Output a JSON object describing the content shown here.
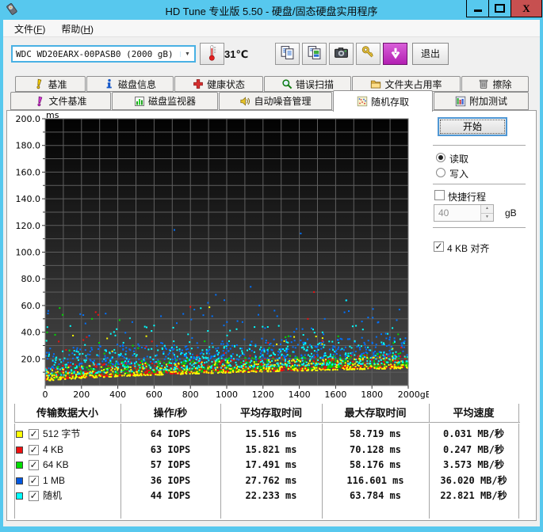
{
  "window": {
    "title": "HD Tune 专业版 5.50 - 硬盘/固态硬盘实用程序",
    "close_glyph": "X"
  },
  "menu": {
    "items": [
      {
        "id": "file",
        "pre": "文件(",
        "accel": "F",
        "post": ")"
      },
      {
        "id": "help",
        "pre": "帮助(",
        "accel": "H",
        "post": ")"
      }
    ]
  },
  "toolbar": {
    "drive_select": {
      "value": "WDC WD20EARX-00PASB0 (2000 gB)",
      "icon": "dropdown-arrow-icon"
    },
    "thermometer_icon": "thermometer-icon",
    "temperature": "31℃",
    "buttons": [
      {
        "icon": "copy-text-icon"
      },
      {
        "icon": "copy-image-icon"
      },
      {
        "icon": "screenshot-icon"
      },
      {
        "icon": "options-icon"
      },
      {
        "icon": "update-icon"
      }
    ],
    "exit_label": "退出"
  },
  "tabs": {
    "row1": [
      {
        "id": "benchmark",
        "label": "基准",
        "icon": "benchmark-icon"
      },
      {
        "id": "disk-info",
        "label": "磁盘信息",
        "icon": "disk-info-icon"
      },
      {
        "id": "health",
        "label": "健康状态",
        "icon": "health-icon"
      },
      {
        "id": "error-scan",
        "label": "错误扫描",
        "icon": "error-scan-icon"
      },
      {
        "id": "folder-usage",
        "label": "文件夹占用率",
        "icon": "folder-usage-icon"
      },
      {
        "id": "erase",
        "label": "擦除",
        "icon": "erase-icon"
      }
    ],
    "row2": [
      {
        "id": "file-benchmark",
        "label": "文件基准",
        "icon": "file-benchmark-icon"
      },
      {
        "id": "disk-monitor",
        "label": "磁盘监视器",
        "icon": "disk-monitor-icon"
      },
      {
        "id": "aam",
        "label": "自动噪音管理",
        "icon": "aam-icon"
      },
      {
        "id": "random-access",
        "label": "随机存取",
        "icon": "random-access-icon",
        "active": true
      },
      {
        "id": "extra-tests",
        "label": "附加测试",
        "icon": "extra-tests-icon"
      }
    ]
  },
  "controls": {
    "start_label": "开始",
    "read_label": "读取",
    "write_label": "写入",
    "read_selected": true,
    "short_stroke_label": "快捷行程",
    "short_stroke_checked": false,
    "stroke_value": "40",
    "stroke_unit": "gB",
    "align_label": "4 KB 对齐",
    "align_checked": true
  },
  "chart_data": {
    "type": "scatter",
    "y_unit": "ms",
    "x_unit": "gB",
    "xlim": [
      0,
      2000
    ],
    "ylim": [
      0,
      200
    ],
    "x_ticks": [
      0,
      200,
      400,
      600,
      800,
      1000,
      1200,
      1400,
      1600,
      1800,
      2000
    ],
    "x_tick_labels": [
      "0",
      "200",
      "400",
      "600",
      "800",
      "1000",
      "1200",
      "1400",
      "1600",
      "1800",
      "2000gB"
    ],
    "y_ticks": [
      20,
      40,
      60,
      80,
      100,
      120,
      140,
      160,
      180,
      200
    ],
    "y_tick_labels": [
      "20.0",
      "40.0",
      "60.0",
      "80.0",
      "100.0",
      "120.0",
      "140.0",
      "160.0",
      "180.0",
      "200.0"
    ],
    "grid": {
      "x_step": 100,
      "y_step": 10,
      "color": "#5f5f5f"
    },
    "background": {
      "top": "#020202",
      "bottom": "#4a4a4a"
    },
    "draw_order": [
      "1 MB",
      "64 KB",
      "4 KB",
      "512 字节",
      "随机"
    ],
    "series": [
      {
        "name": "512 字节",
        "color": "#ffff00",
        "count": 520,
        "env_start": 3,
        "env_end": 13,
        "spread": 9,
        "p": 2.3,
        "high_count": 10,
        "high_min": 22,
        "high_max": 38,
        "max_ms": 58.7,
        "outliers": [
          [
            905,
            58.7
          ],
          [
            557,
            37
          ]
        ]
      },
      {
        "name": "4 KB",
        "color": "#f01010",
        "count": 520,
        "env_start": 3.5,
        "env_end": 13.5,
        "spread": 10,
        "p": 2.3,
        "high_count": 12,
        "high_min": 22,
        "high_max": 42,
        "max_ms": 70.1,
        "outliers": [
          [
            1481,
            70.1
          ],
          [
            278,
            55
          ],
          [
            800,
            59
          ],
          [
            1447,
            50
          ],
          [
            292,
            53
          ]
        ]
      },
      {
        "name": "64 KB",
        "color": "#00dd00",
        "count": 520,
        "env_start": 4,
        "env_end": 14.5,
        "spread": 10,
        "p": 2.1,
        "high_count": 14,
        "high_min": 23,
        "high_max": 40,
        "max_ms": 58.2,
        "outliers": [
          [
            80,
            58.1
          ],
          [
            96,
            53
          ],
          [
            258,
            50
          ],
          [
            1340,
            37
          ],
          [
            410,
            49
          ]
        ]
      },
      {
        "name": "1 MB",
        "color": "#0072ff",
        "count": 430,
        "env_start": 12,
        "env_end": 22,
        "spread": 15,
        "p": 1.7,
        "high_count": 45,
        "high_min": 33,
        "high_max": 58,
        "max_ms": 116.6,
        "outliers": [
          [
            712,
            116.6
          ],
          [
            1408,
            114
          ],
          [
            1132,
            74
          ],
          [
            940,
            68
          ],
          [
            897,
            62
          ],
          [
            1660,
            64
          ],
          [
            987,
            64
          ],
          [
            1278,
            52
          ],
          [
            822,
            57
          ],
          [
            1180,
            60
          ],
          [
            920,
            52
          ],
          [
            1540,
            50
          ],
          [
            638,
            52
          ],
          [
            1745,
            48
          ]
        ]
      },
      {
        "name": "随机",
        "color": "#00ffff",
        "count": 470,
        "env_start": 6,
        "env_end": 17,
        "spread": 18,
        "p": 1.8,
        "high_count": 40,
        "high_min": 28,
        "high_max": 46,
        "max_ms": 63.8,
        "outliers": [
          [
            1658,
            63.8
          ],
          [
            857,
            58
          ],
          [
            600,
            45
          ],
          [
            1750,
            42
          ]
        ]
      }
    ]
  },
  "table": {
    "headers": [
      "传输数据大小",
      "操作/秒",
      "平均存取时间",
      "最大存取时间",
      "平均速度"
    ],
    "rows": [
      {
        "color": "#ffff00",
        "label": "512 字节",
        "checked": true,
        "iops": "64 IOPS",
        "avg_access": "15.516 ms",
        "max_access": "58.719 ms",
        "avg_speed": "0.031 MB/秒"
      },
      {
        "color": "#f01010",
        "label": "4 KB",
        "checked": true,
        "iops": "63 IOPS",
        "avg_access": "15.821 ms",
        "max_access": "70.128 ms",
        "avg_speed": "0.247 MB/秒"
      },
      {
        "color": "#00dd00",
        "label": "64 KB",
        "checked": true,
        "iops": "57 IOPS",
        "avg_access": "17.491 ms",
        "max_access": "58.176 ms",
        "avg_speed": "3.573 MB/秒"
      },
      {
        "color": "#0057e0",
        "label": "1 MB",
        "checked": true,
        "iops": "36 IOPS",
        "avg_access": "27.762 ms",
        "max_access": "116.601 ms",
        "avg_speed": "36.020 MB/秒"
      },
      {
        "color": "#00ffff",
        "label": "随机",
        "checked": true,
        "iops": "44 IOPS",
        "avg_access": "22.233 ms",
        "max_access": "63.784 ms",
        "avg_speed": "22.821 MB/秒"
      }
    ]
  }
}
